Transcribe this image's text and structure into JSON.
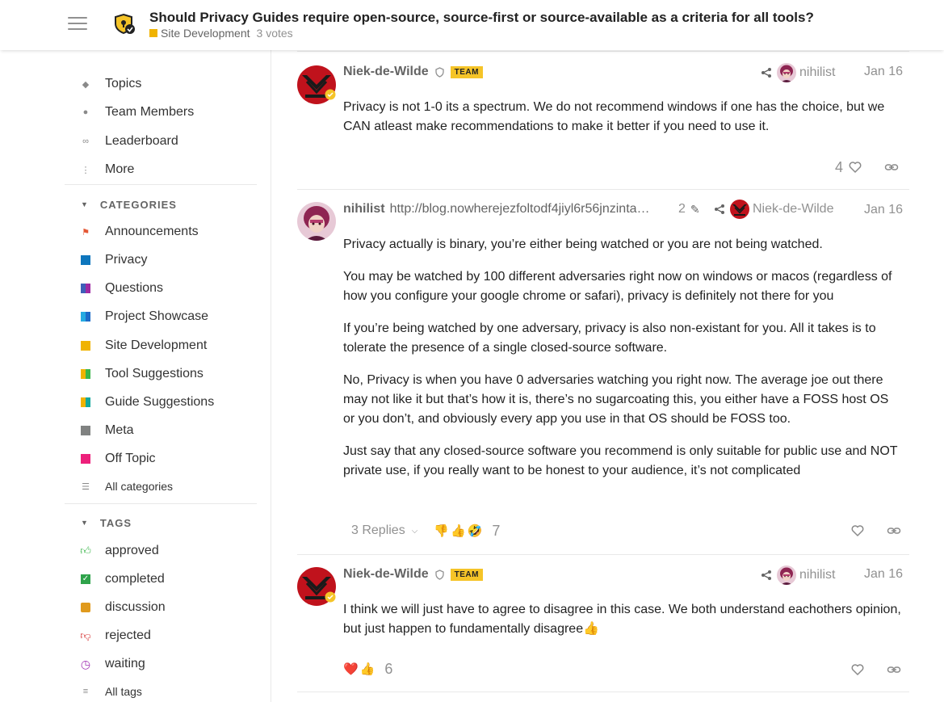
{
  "header": {
    "title": "Should Privacy Guides require open-source, source-first or source-available as a criteria for all tools?",
    "category": "Site Development",
    "category_color": "#f0b300",
    "votes": "3 votes"
  },
  "sidebar": {
    "top_items": [
      {
        "label": "Topics",
        "icon": "layers-icon"
      },
      {
        "label": "Team Members",
        "icon": "robot-icon"
      },
      {
        "label": "Leaderboard",
        "icon": "link-icon"
      },
      {
        "label": "More",
        "icon": "more-vertical-icon"
      }
    ],
    "categories_heading": "CATEGORIES",
    "categories": [
      {
        "label": "Announcements",
        "color": "#e45735"
      },
      {
        "label": "Privacy",
        "color": "#0e76bd"
      },
      {
        "label": "Questions",
        "color": "#3e5fb8",
        "color2": "#9e2aa3"
      },
      {
        "label": "Project Showcase",
        "color": "#25aae1",
        "color2": "#1c6bc8"
      },
      {
        "label": "Site Development",
        "color": "#f0b300"
      },
      {
        "label": "Tool Suggestions",
        "color": "#f0b300",
        "color2": "#3ab54a"
      },
      {
        "label": "Guide Suggestions",
        "color": "#f0b300",
        "color2": "#12a89d"
      },
      {
        "label": "Meta",
        "color": "#808281"
      },
      {
        "label": "Off Topic",
        "color": "#ed207b"
      }
    ],
    "all_categories": "All categories",
    "tags_heading": "TAGS",
    "tags": [
      {
        "label": "approved",
        "icon": "thumbs-up-icon",
        "color": "#3ab54a"
      },
      {
        "label": "completed",
        "icon": "check-square-icon",
        "color": "#2fa34b"
      },
      {
        "label": "discussion",
        "icon": "comment-icon",
        "color": "#e09a1d"
      },
      {
        "label": "rejected",
        "icon": "thumbs-down-icon",
        "color": "#d63434"
      },
      {
        "label": "waiting",
        "icon": "clock-icon",
        "color": "#a235b5"
      }
    ],
    "all_tags": "All tags"
  },
  "posts": [
    {
      "username": "Niek-de-Wilde",
      "badge": "TEAM",
      "reply_to": "nihilist",
      "date": "Jan 16",
      "paragraphs": [
        "Privacy is not 1-0 its a spectrum. We do not recommend windows if one has the choice, but we CAN atleast make recommendations to make it better if you need to use it."
      ],
      "likes": "4"
    },
    {
      "username": "nihilist",
      "user_link": "http://blog.nowherejezfoltodf4jiyl6r56jnzinta…",
      "edits": "2",
      "reply_to": "Niek-de-Wilde",
      "date": "Jan 16",
      "paragraphs": [
        "Privacy actually is binary, you’re either being watched or you are not being watched.",
        "You may be watched by 100 different adversaries right now on windows or macos (regardless of how you configure your google chrome or safari), privacy is definitely not there for you",
        "If you’re being watched by one adversary, privacy is also non-existant for you. All it takes is to tolerate the presence of a single closed-source software.",
        "No, Privacy is when you have 0 adversaries watching you right now. The average joe out there may not like it but that’s how it is, there’s no sugarcoating this, you either have a FOSS host OS or you don’t, and obviously every app you use in that OS should be FOSS too.",
        "Just say that any closed-source software you recommend is only suitable for public use and NOT private use, if you really want to be honest to your audience, it’s not complicated"
      ],
      "replies": "3 Replies",
      "reactions": [
        "👎",
        "👍",
        "🤣"
      ],
      "reaction_count": "7"
    },
    {
      "username": "Niek-de-Wilde",
      "badge": "TEAM",
      "reply_to": "nihilist",
      "date": "Jan 16",
      "paragraphs": [
        "I think we will just have to agree to disagree in this case. We both understand eachothers opinion, but just happen to fundamentally disagree👍"
      ],
      "reactions": [
        "❤️",
        "👍"
      ],
      "reaction_count": "6"
    }
  ]
}
